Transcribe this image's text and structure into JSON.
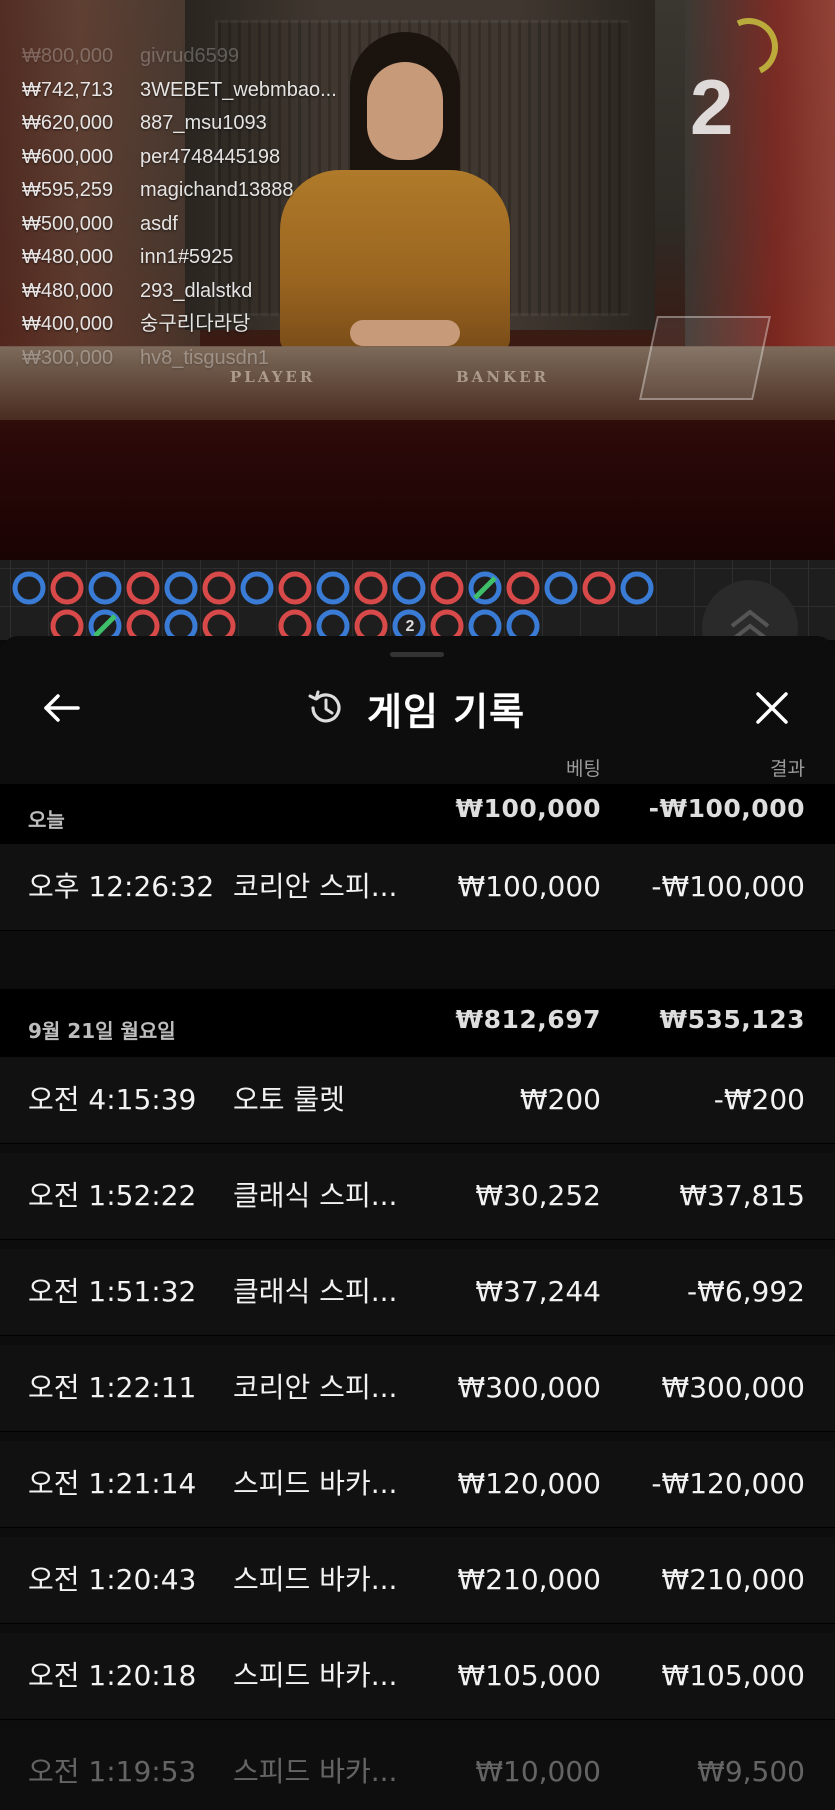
{
  "video": {
    "round_number": "2",
    "table_labels": {
      "player": "PLAYER",
      "banker": "BANKER"
    },
    "winners": [
      {
        "amount": "₩800,000",
        "name": "givrud6599"
      },
      {
        "amount": "₩742,713",
        "name": "3WEBET_webmbao..."
      },
      {
        "amount": "₩620,000",
        "name": "887_msu1093"
      },
      {
        "amount": "₩600,000",
        "name": "per4748445198"
      },
      {
        "amount": "₩595,259",
        "name": "magichand13888"
      },
      {
        "amount": "₩500,000",
        "name": "asdf"
      },
      {
        "amount": "₩480,000",
        "name": "inn1#5925"
      },
      {
        "amount": "₩480,000",
        "name": "293_dlalstkd"
      },
      {
        "amount": "₩400,000",
        "name": "숭구리다라당"
      },
      {
        "amount": "₩300,000",
        "name": "hv8_tisgusdn1"
      }
    ]
  },
  "road": {
    "colors": {
      "player": "#3a7bd5",
      "banker": "#d84a4a",
      "tie": "#3fbf6a"
    },
    "top_row": [
      "P",
      "B",
      "P",
      "B",
      "P",
      "B",
      "P",
      "B",
      "P",
      "B",
      "P",
      "B",
      "P",
      "B",
      "P",
      "B",
      "P"
    ],
    "bottom_row": [
      "B",
      "P",
      "B",
      "P",
      "B",
      "",
      "B",
      "P",
      "B",
      "P",
      "B",
      "P",
      "P"
    ],
    "marker": "2"
  },
  "sheet": {
    "title": "게임 기록",
    "columns": {
      "bet": "베팅",
      "result": "결과"
    },
    "groups": [
      {
        "date": "오늘",
        "total_bet": "₩100,000",
        "total_result": "-₩100,000",
        "rows": [
          {
            "time": "오후 12:26:32",
            "game": "코리안 스피...",
            "bet": "₩100,000",
            "result": "-₩100,000"
          }
        ]
      },
      {
        "date": "9월 21일 월요일",
        "total_bet": "₩812,697",
        "total_result": "₩535,123",
        "rows": [
          {
            "time": "오전 4:15:39",
            "game": "오토 룰렛",
            "bet": "₩200",
            "result": "-₩200"
          },
          {
            "time": "오전 1:52:22",
            "game": "클래식 스피...",
            "bet": "₩30,252",
            "result": "₩37,815"
          },
          {
            "time": "오전 1:51:32",
            "game": "클래식 스피...",
            "bet": "₩37,244",
            "result": "-₩6,992"
          },
          {
            "time": "오전 1:22:11",
            "game": "코리안 스피...",
            "bet": "₩300,000",
            "result": "₩300,000"
          },
          {
            "time": "오전 1:21:14",
            "game": "스피드 바카...",
            "bet": "₩120,000",
            "result": "-₩120,000"
          },
          {
            "time": "오전 1:20:43",
            "game": "스피드 바카...",
            "bet": "₩210,000",
            "result": "₩210,000"
          },
          {
            "time": "오전 1:20:18",
            "game": "스피드 바카...",
            "bet": "₩105,000",
            "result": "₩105,000"
          },
          {
            "time": "오전 1:19:53",
            "game": "스피드 바카...",
            "bet": "₩10,000",
            "result": "₩9,500"
          }
        ]
      }
    ]
  }
}
